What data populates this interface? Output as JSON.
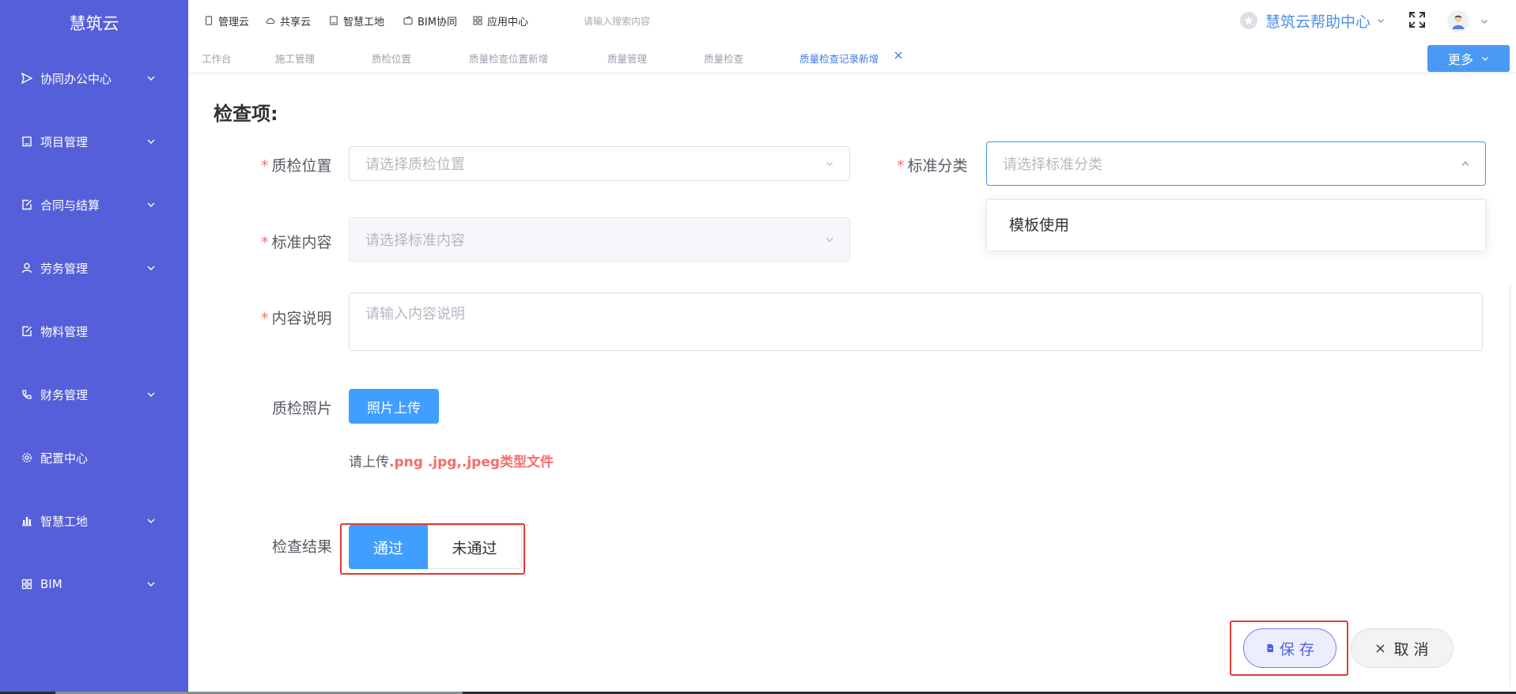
{
  "brand": {
    "title": "慧筑云"
  },
  "sidebar": {
    "items": [
      {
        "label": "协同办公中心",
        "icon": "send-icon",
        "expandable": true
      },
      {
        "label": "项目管理",
        "icon": "book-icon",
        "expandable": true
      },
      {
        "label": "合同与结算",
        "icon": "edit-doc-icon",
        "expandable": true
      },
      {
        "label": "劳务管理",
        "icon": "user-icon",
        "expandable": true
      },
      {
        "label": "物料管理",
        "icon": "edit-doc-icon",
        "expandable": false
      },
      {
        "label": "财务管理",
        "icon": "phone-icon",
        "expandable": true
      },
      {
        "label": "配置中心",
        "icon": "gear-icon",
        "expandable": false
      },
      {
        "label": "智慧工地",
        "icon": "bar-chart-icon",
        "expandable": true
      },
      {
        "label": "BIM",
        "icon": "grid-icon",
        "expandable": true
      }
    ]
  },
  "header": {
    "apps": [
      {
        "label": "管理云",
        "icon": "mobile-icon"
      },
      {
        "label": "共享云",
        "icon": "cloud-icon"
      },
      {
        "label": "智慧工地",
        "icon": "book-icon"
      },
      {
        "label": "BIM协同",
        "icon": "wallet-icon"
      },
      {
        "label": "应用中心",
        "icon": "grid-icon"
      }
    ],
    "search_placeholder": "请输入搜索内容",
    "help_label": "慧筑云帮助中心"
  },
  "tabs": {
    "items": [
      {
        "label": "工作台"
      },
      {
        "label": "施工管理"
      },
      {
        "label": "质检位置"
      },
      {
        "label": "质量检查位置新增"
      },
      {
        "label": "质量管理"
      },
      {
        "label": "质量检查"
      },
      {
        "label": "质量检查记录新增",
        "active": true
      }
    ],
    "more_label": "更多"
  },
  "form": {
    "section_title": "检查项:",
    "location_label": "质检位置",
    "location_placeholder": "请选择质检位置",
    "category_label": "标准分类",
    "category_placeholder": "请选择标准分类",
    "category_options": [
      "模板使用"
    ],
    "content_label": "标准内容",
    "content_placeholder": "请选择标准内容",
    "desc_label": "内容说明",
    "desc_placeholder": "请输入内容说明",
    "photo_label": "质检照片",
    "upload_label": "照片上传",
    "upload_hint_prefix": "请上传",
    "upload_hint_types": ".png .jpg,.jpeg类型文件",
    "result_label": "检查结果",
    "result_options": {
      "pass": "通过",
      "fail": "未通过"
    },
    "result_selected": "通过",
    "save_label": "保 存",
    "cancel_label": "取 消"
  },
  "colors": {
    "sidebar_bg": "#555fd9",
    "primary": "#409eff",
    "required": "#f56c6c",
    "highlight_box": "#e53935"
  }
}
